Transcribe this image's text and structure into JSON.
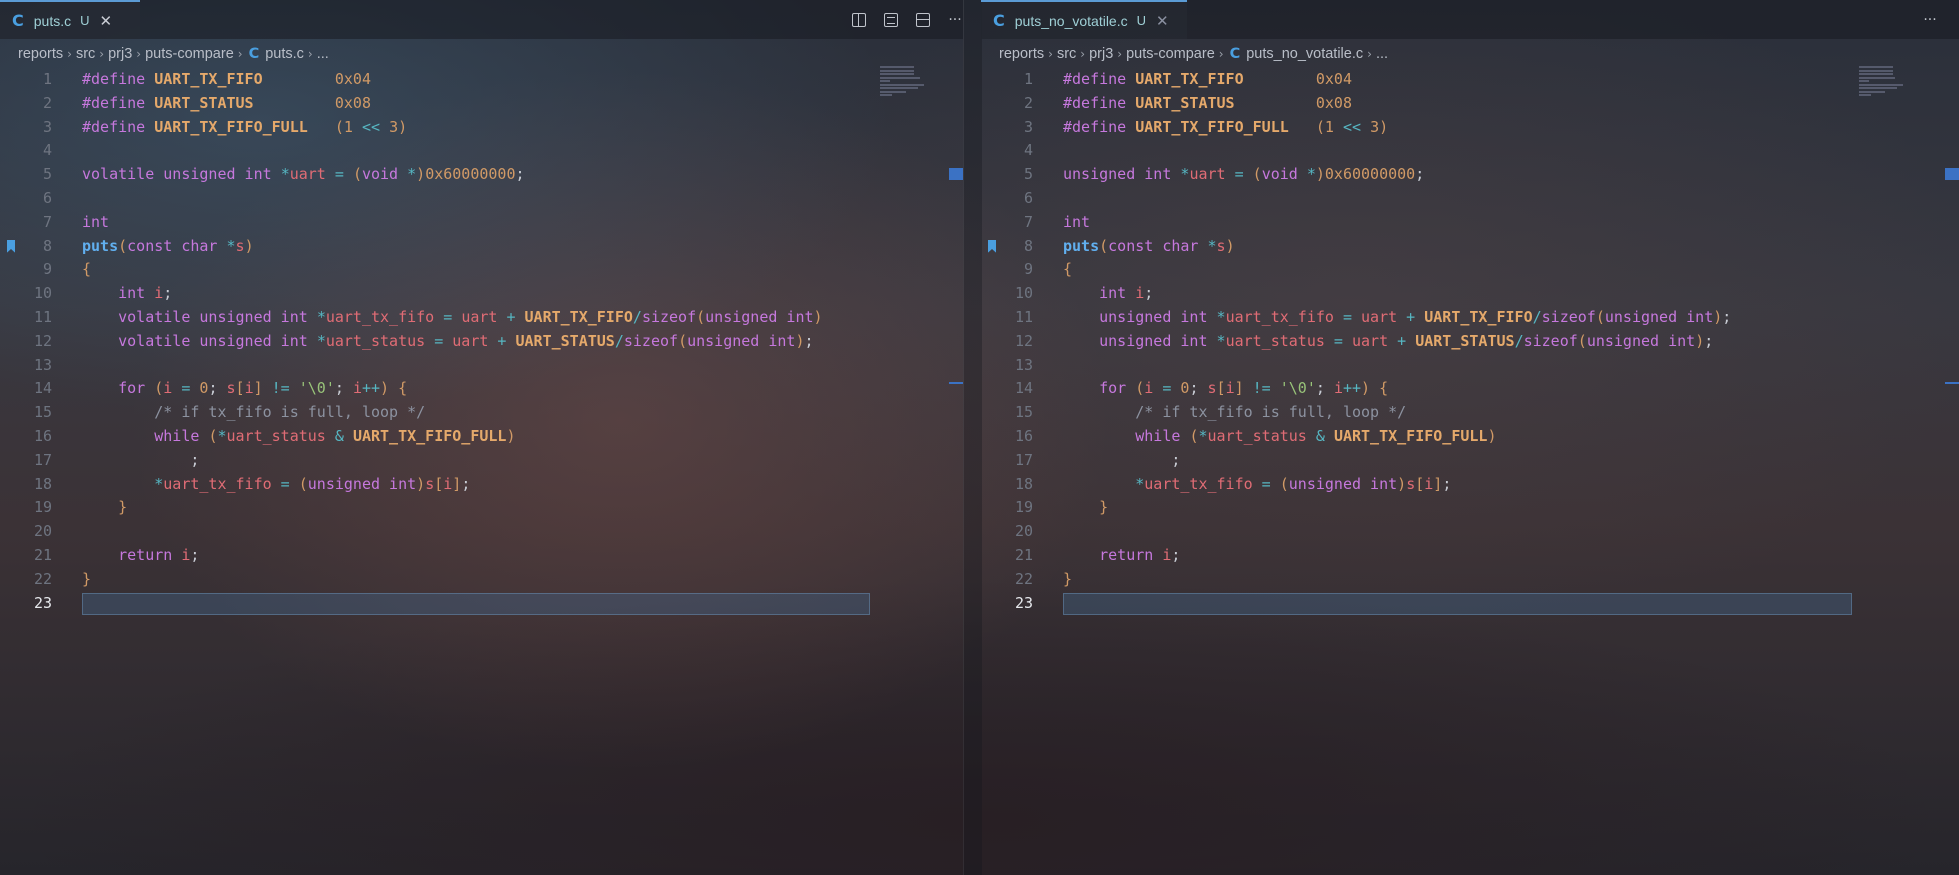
{
  "left": {
    "tab": {
      "icon": "C",
      "label": "puts.c",
      "modified": "U"
    },
    "breadcrumb": [
      "reports",
      "src",
      "prj3",
      "puts-compare"
    ],
    "breadcrumb_file": "puts.c",
    "breadcrumb_more": "...",
    "active_line": 23,
    "bookmark_line": 8,
    "code": [
      [
        [
          "k",
          "#define "
        ],
        [
          "m",
          "UART_TX_FIFO"
        ],
        [
          "pl",
          "        "
        ],
        [
          "n",
          "0x04"
        ]
      ],
      [
        [
          "k",
          "#define "
        ],
        [
          "m",
          "UART_STATUS"
        ],
        [
          "pl",
          "         "
        ],
        [
          "n",
          "0x08"
        ]
      ],
      [
        [
          "k",
          "#define "
        ],
        [
          "m",
          "UART_TX_FIFO_FULL"
        ],
        [
          "pl",
          "   "
        ],
        [
          "p",
          "("
        ],
        [
          "n",
          "1"
        ],
        [
          "o",
          " << "
        ],
        [
          "n",
          "3"
        ],
        [
          "p",
          ")"
        ]
      ],
      [],
      [
        [
          "k",
          "volatile "
        ],
        [
          "t",
          "unsigned int "
        ],
        [
          "o",
          "*"
        ],
        [
          "v",
          "uart"
        ],
        [
          "o",
          " = "
        ],
        [
          "p",
          "("
        ],
        [
          "t",
          "void "
        ],
        [
          "o",
          "*"
        ],
        [
          "p",
          ")"
        ],
        [
          "n",
          "0x60000000"
        ],
        [
          "pl",
          ";"
        ]
      ],
      [],
      [
        [
          "t",
          "int"
        ]
      ],
      [
        [
          "f",
          "puts"
        ],
        [
          "p",
          "("
        ],
        [
          "k",
          "const "
        ],
        [
          "t",
          "char "
        ],
        [
          "o",
          "*"
        ],
        [
          "v",
          "s"
        ],
        [
          "p",
          ")"
        ]
      ],
      [
        [
          "p",
          "{"
        ]
      ],
      [
        [
          "pl",
          "    "
        ],
        [
          "t",
          "int "
        ],
        [
          "v",
          "i"
        ],
        [
          "pl",
          ";"
        ]
      ],
      [
        [
          "pl",
          "    "
        ],
        [
          "k",
          "volatile "
        ],
        [
          "t",
          "unsigned int "
        ],
        [
          "o",
          "*"
        ],
        [
          "v",
          "uart_tx_fifo"
        ],
        [
          "o",
          " = "
        ],
        [
          "v",
          "uart"
        ],
        [
          "o",
          " + "
        ],
        [
          "m",
          "UART_TX_FIFO"
        ],
        [
          "o",
          "/"
        ],
        [
          "k",
          "sizeof"
        ],
        [
          "p",
          "("
        ],
        [
          "t",
          "unsigned int"
        ],
        [
          "p",
          ")"
        ]
      ],
      [
        [
          "pl",
          "    "
        ],
        [
          "k",
          "volatile "
        ],
        [
          "t",
          "unsigned int "
        ],
        [
          "o",
          "*"
        ],
        [
          "v",
          "uart_status"
        ],
        [
          "o",
          " = "
        ],
        [
          "v",
          "uart"
        ],
        [
          "o",
          " + "
        ],
        [
          "m",
          "UART_STATUS"
        ],
        [
          "o",
          "/"
        ],
        [
          "k",
          "sizeof"
        ],
        [
          "p",
          "("
        ],
        [
          "t",
          "unsigned int"
        ],
        [
          "p",
          ")"
        ],
        [
          "pl",
          ";"
        ]
      ],
      [],
      [
        [
          "pl",
          "    "
        ],
        [
          "k",
          "for "
        ],
        [
          "p",
          "("
        ],
        [
          "v",
          "i"
        ],
        [
          "o",
          " = "
        ],
        [
          "n",
          "0"
        ],
        [
          "pl",
          "; "
        ],
        [
          "v",
          "s"
        ],
        [
          "p",
          "["
        ],
        [
          "v",
          "i"
        ],
        [
          "p",
          "]"
        ],
        [
          "o",
          " != "
        ],
        [
          "s",
          "'\\0'"
        ],
        [
          "pl",
          "; "
        ],
        [
          "v",
          "i"
        ],
        [
          "o",
          "++"
        ],
        [
          "p",
          ")"
        ],
        [
          "pl",
          " "
        ],
        [
          "p",
          "{"
        ]
      ],
      [
        [
          "pl",
          "        "
        ],
        [
          "cm",
          "/* if tx_fifo is full, loop */"
        ]
      ],
      [
        [
          "pl",
          "        "
        ],
        [
          "k",
          "while "
        ],
        [
          "p",
          "("
        ],
        [
          "o",
          "*"
        ],
        [
          "v",
          "uart_status"
        ],
        [
          "o",
          " & "
        ],
        [
          "m",
          "UART_TX_FIFO_FULL"
        ],
        [
          "p",
          ")"
        ]
      ],
      [
        [
          "pl",
          "            ;"
        ]
      ],
      [
        [
          "pl",
          "        "
        ],
        [
          "o",
          "*"
        ],
        [
          "v",
          "uart_tx_fifo"
        ],
        [
          "o",
          " = "
        ],
        [
          "p",
          "("
        ],
        [
          "t",
          "unsigned int"
        ],
        [
          "p",
          ")"
        ],
        [
          "v",
          "s"
        ],
        [
          "p",
          "["
        ],
        [
          "v",
          "i"
        ],
        [
          "p",
          "]"
        ],
        [
          "pl",
          ";"
        ]
      ],
      [
        [
          "pl",
          "    "
        ],
        [
          "p",
          "}"
        ]
      ],
      [],
      [
        [
          "pl",
          "    "
        ],
        [
          "k",
          "return "
        ],
        [
          "v",
          "i"
        ],
        [
          "pl",
          ";"
        ]
      ],
      [
        [
          "p",
          "}"
        ]
      ],
      []
    ]
  },
  "right": {
    "tab": {
      "icon": "C",
      "label": "puts_no_votatile.c",
      "modified": "U"
    },
    "breadcrumb": [
      "reports",
      "src",
      "prj3",
      "puts-compare"
    ],
    "breadcrumb_file": "puts_no_votatile.c",
    "breadcrumb_more": "...",
    "active_line": 23,
    "bookmark_line": 8,
    "code": [
      [
        [
          "k",
          "#define "
        ],
        [
          "m",
          "UART_TX_FIFO"
        ],
        [
          "pl",
          "        "
        ],
        [
          "n",
          "0x04"
        ]
      ],
      [
        [
          "k",
          "#define "
        ],
        [
          "m",
          "UART_STATUS"
        ],
        [
          "pl",
          "         "
        ],
        [
          "n",
          "0x08"
        ]
      ],
      [
        [
          "k",
          "#define "
        ],
        [
          "m",
          "UART_TX_FIFO_FULL"
        ],
        [
          "pl",
          "   "
        ],
        [
          "p",
          "("
        ],
        [
          "n",
          "1"
        ],
        [
          "o",
          " << "
        ],
        [
          "n",
          "3"
        ],
        [
          "p",
          ")"
        ]
      ],
      [],
      [
        [
          "t",
          "unsigned int "
        ],
        [
          "o",
          "*"
        ],
        [
          "v",
          "uart"
        ],
        [
          "o",
          " = "
        ],
        [
          "p",
          "("
        ],
        [
          "t",
          "void "
        ],
        [
          "o",
          "*"
        ],
        [
          "p",
          ")"
        ],
        [
          "n",
          "0x60000000"
        ],
        [
          "pl",
          ";"
        ]
      ],
      [],
      [
        [
          "t",
          "int"
        ]
      ],
      [
        [
          "f",
          "puts"
        ],
        [
          "p",
          "("
        ],
        [
          "k",
          "const "
        ],
        [
          "t",
          "char "
        ],
        [
          "o",
          "*"
        ],
        [
          "v",
          "s"
        ],
        [
          "p",
          ")"
        ]
      ],
      [
        [
          "p",
          "{"
        ]
      ],
      [
        [
          "pl",
          "    "
        ],
        [
          "t",
          "int "
        ],
        [
          "v",
          "i"
        ],
        [
          "pl",
          ";"
        ]
      ],
      [
        [
          "pl",
          "    "
        ],
        [
          "t",
          "unsigned int "
        ],
        [
          "o",
          "*"
        ],
        [
          "v",
          "uart_tx_fifo"
        ],
        [
          "o",
          " = "
        ],
        [
          "v",
          "uart"
        ],
        [
          "o",
          " + "
        ],
        [
          "m",
          "UART_TX_FIFO"
        ],
        [
          "o",
          "/"
        ],
        [
          "k",
          "sizeof"
        ],
        [
          "p",
          "("
        ],
        [
          "t",
          "unsigned int"
        ],
        [
          "p",
          ")"
        ],
        [
          "pl",
          ";"
        ]
      ],
      [
        [
          "pl",
          "    "
        ],
        [
          "t",
          "unsigned int "
        ],
        [
          "o",
          "*"
        ],
        [
          "v",
          "uart_status"
        ],
        [
          "o",
          " = "
        ],
        [
          "v",
          "uart"
        ],
        [
          "o",
          " + "
        ],
        [
          "m",
          "UART_STATUS"
        ],
        [
          "o",
          "/"
        ],
        [
          "k",
          "sizeof"
        ],
        [
          "p",
          "("
        ],
        [
          "t",
          "unsigned int"
        ],
        [
          "p",
          ")"
        ],
        [
          "pl",
          ";"
        ]
      ],
      [],
      [
        [
          "pl",
          "    "
        ],
        [
          "k",
          "for "
        ],
        [
          "p",
          "("
        ],
        [
          "v",
          "i"
        ],
        [
          "o",
          " = "
        ],
        [
          "n",
          "0"
        ],
        [
          "pl",
          "; "
        ],
        [
          "v",
          "s"
        ],
        [
          "p",
          "["
        ],
        [
          "v",
          "i"
        ],
        [
          "p",
          "]"
        ],
        [
          "o",
          " != "
        ],
        [
          "s",
          "'\\0'"
        ],
        [
          "pl",
          "; "
        ],
        [
          "v",
          "i"
        ],
        [
          "o",
          "++"
        ],
        [
          "p",
          ")"
        ],
        [
          "pl",
          " "
        ],
        [
          "p",
          "{"
        ]
      ],
      [
        [
          "pl",
          "        "
        ],
        [
          "cm",
          "/* if tx_fifo is full, loop */"
        ]
      ],
      [
        [
          "pl",
          "        "
        ],
        [
          "k",
          "while "
        ],
        [
          "p",
          "("
        ],
        [
          "o",
          "*"
        ],
        [
          "v",
          "uart_status"
        ],
        [
          "o",
          " & "
        ],
        [
          "m",
          "UART_TX_FIFO_FULL"
        ],
        [
          "p",
          ")"
        ]
      ],
      [
        [
          "pl",
          "            ;"
        ]
      ],
      [
        [
          "pl",
          "        "
        ],
        [
          "o",
          "*"
        ],
        [
          "v",
          "uart_tx_fifo"
        ],
        [
          "o",
          " = "
        ],
        [
          "p",
          "("
        ],
        [
          "t",
          "unsigned int"
        ],
        [
          "p",
          ")"
        ],
        [
          "v",
          "s"
        ],
        [
          "p",
          "["
        ],
        [
          "v",
          "i"
        ],
        [
          "p",
          "]"
        ],
        [
          "pl",
          ";"
        ]
      ],
      [
        [
          "pl",
          "    "
        ],
        [
          "p",
          "}"
        ]
      ],
      [],
      [
        [
          "pl",
          "    "
        ],
        [
          "k",
          "return "
        ],
        [
          "v",
          "i"
        ],
        [
          "pl",
          ";"
        ]
      ],
      [
        [
          "p",
          "}"
        ]
      ],
      []
    ]
  },
  "icons": {
    "left_actions": [
      "open-changes-icon",
      "open-preview-icon",
      "split-editor-icon",
      "more-actions-icon"
    ],
    "right_actions": [
      "more-actions-icon"
    ],
    "more_glyph": "···"
  }
}
